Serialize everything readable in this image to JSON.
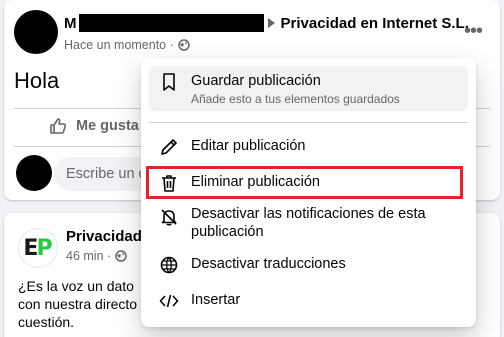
{
  "post": {
    "author_initial": "M",
    "target_page": "Privacidad en Internet S.L.",
    "timestamp": "Hace un momento ·",
    "text": "Hola",
    "like_label": "Me gusta",
    "comment_placeholder": "Escribe un comentario..."
  },
  "page_post": {
    "logo_letters": "EP",
    "name": "Privacidad en Internet",
    "timestamp": "46 min ·",
    "body": "¿Es la voz un dato ... con nuestra directo... cuestión.",
    "body_lines": [
      "¿Es la voz un dato",
      "con nuestra directo",
      "cuestión."
    ]
  },
  "menu": {
    "items": [
      {
        "label": "Guardar publicación",
        "sublabel": "Añade esto a tus elementos guardados",
        "icon": "bookmark-icon"
      },
      {
        "label": "Editar publicación",
        "icon": "pencil-icon"
      },
      {
        "label": "Eliminar publicación",
        "icon": "trash-icon"
      },
      {
        "label": "Desactivar las notificaciones de esta publicación",
        "icon": "bell-off-icon"
      },
      {
        "label": "Desactivar traducciones",
        "icon": "globe-icon"
      },
      {
        "label": "Insertar",
        "icon": "code-icon"
      }
    ]
  },
  "colors": {
    "highlight": "#e8222a",
    "secondary_text": "#65676b",
    "background": "#f0f2f5"
  }
}
